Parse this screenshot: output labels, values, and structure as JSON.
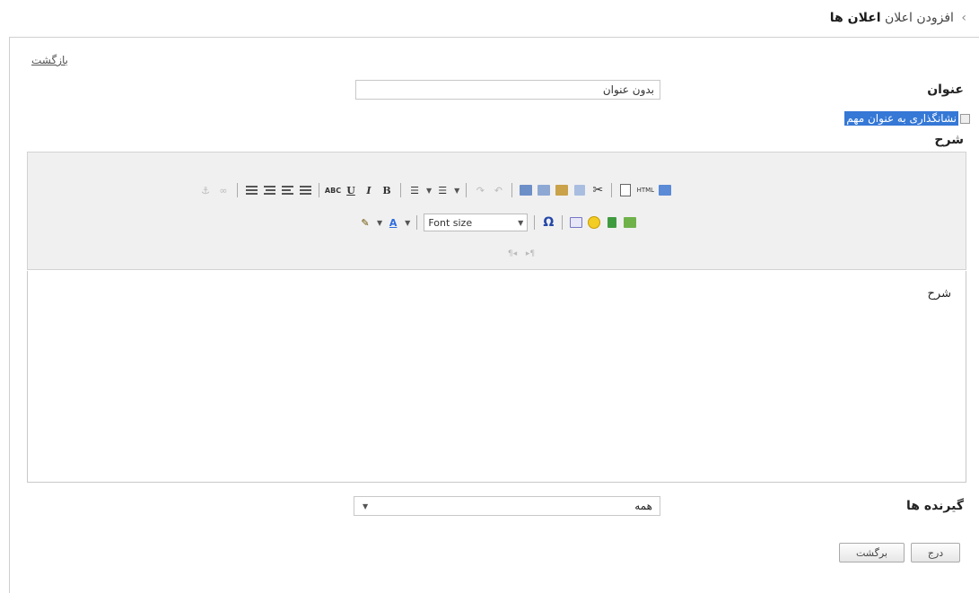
{
  "breadcrumb": {
    "prefix": "افزودن اعلان",
    "current": "اعلان ها"
  },
  "back_link": "بازگشت",
  "form": {
    "title_label": "عنوان",
    "title_value": "بدون عنوان",
    "important_label": "نشانگذاری به عنوان مهم",
    "description_label": "شرح",
    "editor_text": "شرح",
    "recipients_label": "گیرنده ها",
    "recipients_value": "همه"
  },
  "toolbar": {
    "row1_icons": [
      "anchor-icon",
      "unlink-icon",
      "align-right-icon",
      "align-center-icon",
      "align-left-icon",
      "align-justify-icon",
      "spellcheck-icon",
      "underline-icon",
      "italic-icon",
      "bold-icon",
      "ordered-list-icon",
      "unordered-list-icon",
      "redo-icon",
      "undo-icon",
      "paste-word-icon",
      "paste-text-icon",
      "paste-icon",
      "copy-icon",
      "cut-icon",
      "new-page-icon",
      "source-html-icon",
      "preview-icon"
    ],
    "underline": "U",
    "italic": "I",
    "bold": "B",
    "spellcheck": "ABC",
    "html": "HTML",
    "font_size": "Font size",
    "omega": "Ω",
    "text_color": "A"
  },
  "buttons": {
    "insert": "درج",
    "back": "برگشت"
  }
}
